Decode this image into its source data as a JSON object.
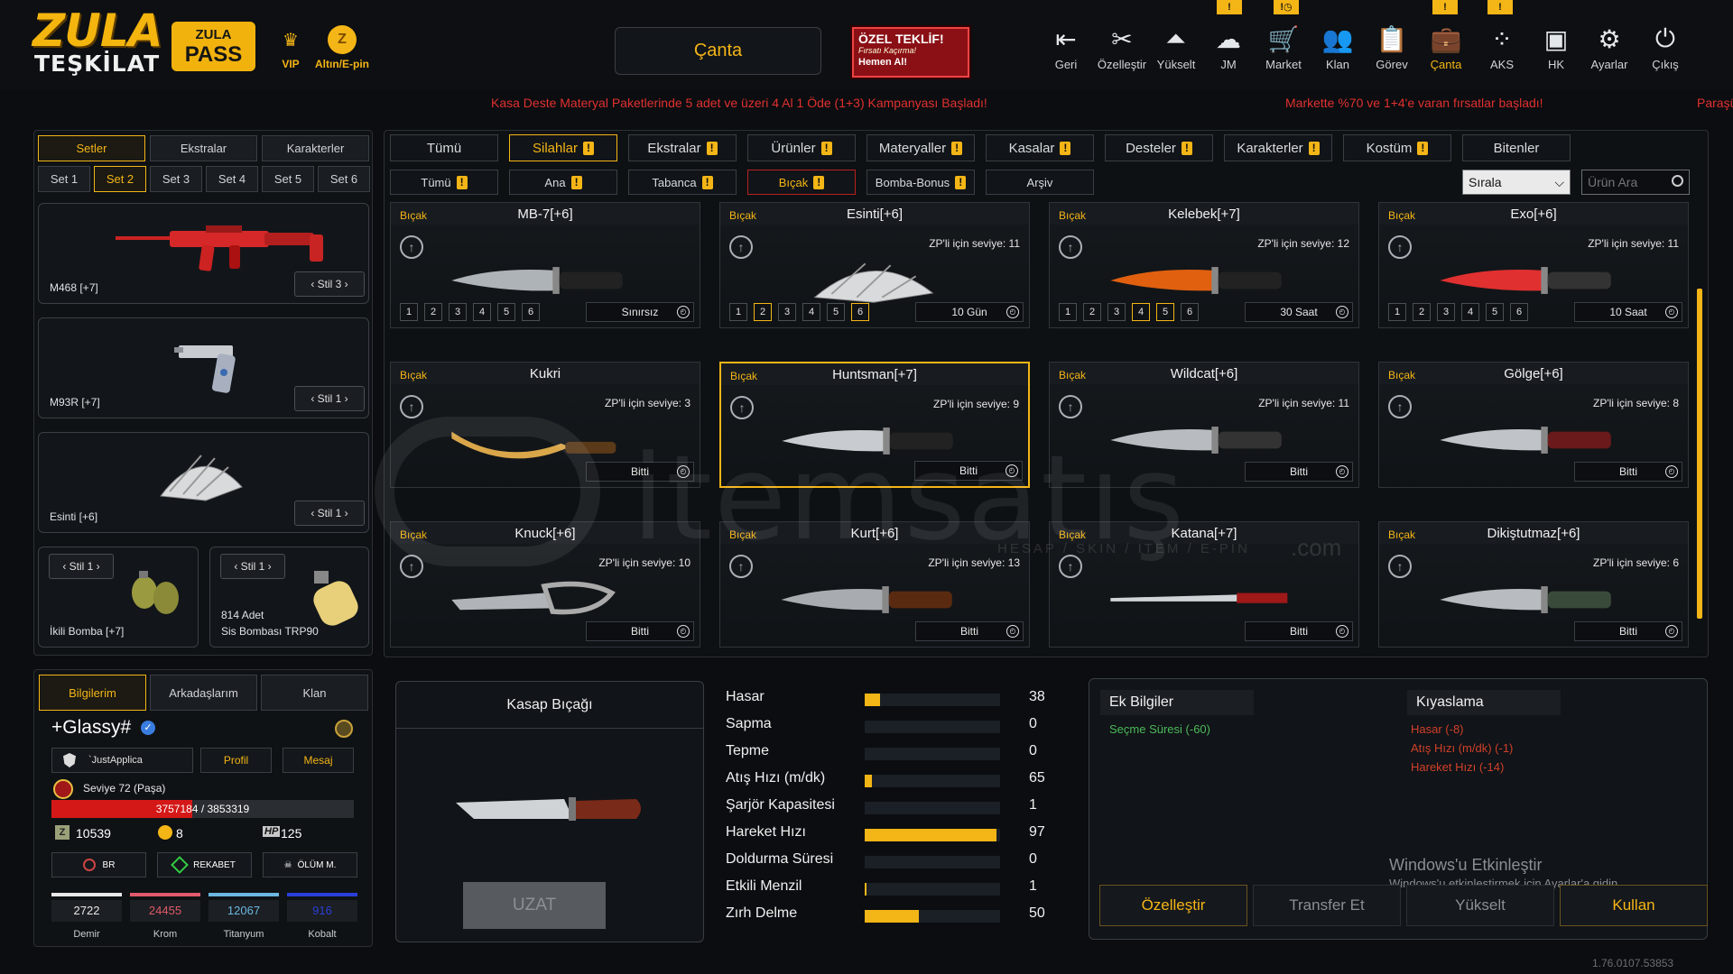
{
  "app": {
    "logo_line1": "ZULA",
    "logo_line2": "TEŞKİLAT",
    "pass_line1": "ZULA",
    "pass_line2": "PASS",
    "vip_label": "VIP",
    "epin_label": "Altın/E-pin",
    "canta_button": "Çanta",
    "offer_title": "ÖZEL TEKLİF!",
    "offer_sub": "Fırsatı Kaçırma!",
    "offer_cta": "Hemen Al!",
    "version": "1.76.0107.53853"
  },
  "nav": [
    {
      "label": "Geri",
      "icon": "back-icon"
    },
    {
      "label": "Özelleştir",
      "icon": "tools-icon"
    },
    {
      "label": "Yükselt",
      "icon": "upgrade-icon"
    },
    {
      "label": "JM",
      "icon": "cloud-icon"
    },
    {
      "label": "Market",
      "icon": "cart-icon"
    },
    {
      "label": "Klan",
      "icon": "clan-icon"
    },
    {
      "label": "Görev",
      "icon": "clipboard-icon"
    },
    {
      "label": "Çanta",
      "icon": "bag-icon"
    },
    {
      "label": "AKS",
      "icon": "dots-icon"
    },
    {
      "label": "HK",
      "icon": "wallet-icon"
    },
    {
      "label": "Ayarlar",
      "icon": "gear-icon"
    },
    {
      "label": "Çıkış",
      "icon": "power-icon"
    }
  ],
  "ticker": [
    "Kasa Deste Materyal Paketlerinde 5 adet ve üzeri 4 Al 1 Öde (1+3) Kampanyası Başladı!",
    "Markette %70 ve 1+4'e varan fırsatlar başladı!",
    "Paraşü"
  ],
  "left": {
    "tabs": [
      "Setler",
      "Ekstralar",
      "Karakterler"
    ],
    "sets": [
      "Set 1",
      "Set 2",
      "Set 3",
      "Set 4",
      "Set 5",
      "Set 6"
    ],
    "slots": [
      {
        "name": "M468 [+7]",
        "stil": "Stil 3"
      },
      {
        "name": "M93R [+7]",
        "stil": "Stil 1"
      },
      {
        "name": "Esinti [+6]",
        "stil": "Stil 1"
      },
      {
        "name": "İkili Bomba [+7]",
        "stil": "Stil 1"
      },
      {
        "name": "Sis Bombası TRP90",
        "stil": "Stil 1",
        "count": "814 Adet"
      }
    ]
  },
  "profile": {
    "tabs": [
      "Bilgilerim",
      "Arkadaşlarım",
      "Klan"
    ],
    "username": "+Glassy#",
    "clan": "`JustApplica",
    "profil_btn": "Profil",
    "mesaj_btn": "Mesaj",
    "level": "Seviye 72 (Paşa)",
    "xp_current": "3757184",
    "xp_total": "/ 3853319",
    "xp_progress": 0.975,
    "zp": "10539",
    "gold": "8",
    "hp_label": "HP",
    "hp": "125",
    "modes": [
      "BR",
      "REKABET",
      "ÖLÜM M."
    ],
    "materials": [
      {
        "label": "Demir",
        "value": "2722",
        "color": "#e8e8e8"
      },
      {
        "label": "Krom",
        "value": "24455",
        "color": "#e05a6a"
      },
      {
        "label": "Titanyum",
        "value": "12067",
        "color": "#6ab8e0"
      },
      {
        "label": "Kobalt",
        "value": "916",
        "color": "#2a3fd8"
      }
    ]
  },
  "catalog": {
    "tabs1": [
      "Tümü",
      "Silahlar",
      "Ekstralar",
      "Ürünler",
      "Materyaller",
      "Kasalar",
      "Desteler",
      "Karakterler",
      "Kostüm",
      "Bitenler"
    ],
    "tabs2": [
      "Tümü",
      "Ana",
      "Tabanca",
      "Bıçak",
      "Bomba-Bonus",
      "Arşiv"
    ],
    "sort_label": "Sırala",
    "search_placeholder": "Ürün Ara",
    "items": [
      {
        "cat": "Bıçak",
        "name": "MB-7[+6]",
        "zp": "",
        "dur": "Sınırsız",
        "levels": [
          "1",
          "2",
          "3",
          "4",
          "5",
          "6"
        ],
        "on": []
      },
      {
        "cat": "Bıçak",
        "name": "Esinti[+6]",
        "zp": "ZP'li için seviye: 11",
        "dur": "10 Gün",
        "levels": [
          "1",
          "2",
          "3",
          "4",
          "5",
          "6"
        ],
        "on": [
          1,
          5
        ]
      },
      {
        "cat": "Bıçak",
        "name": "Kelebek[+7]",
        "zp": "ZP'li için seviye: 12",
        "dur": "30 Saat",
        "levels": [
          "1",
          "2",
          "3",
          "4",
          "5",
          "6"
        ],
        "on": [
          3,
          4
        ]
      },
      {
        "cat": "Bıçak",
        "name": "Exo[+6]",
        "zp": "ZP'li için seviye: 11",
        "dur": "10 Saat",
        "levels": [
          "1",
          "2",
          "3",
          "4",
          "5",
          "6"
        ],
        "on": []
      },
      {
        "cat": "Bıçak",
        "name": "Kukri",
        "zp": "ZP'li için seviye: 3",
        "dur": "Bitti",
        "levels": [],
        "on": []
      },
      {
        "cat": "Bıçak",
        "name": "Huntsman[+7]",
        "zp": "ZP'li için seviye: 9",
        "dur": "Bitti",
        "levels": [],
        "on": []
      },
      {
        "cat": "Bıçak",
        "name": "Wildcat[+6]",
        "zp": "ZP'li için seviye: 11",
        "dur": "Bitti",
        "levels": [],
        "on": []
      },
      {
        "cat": "Bıçak",
        "name": "Gölge[+6]",
        "zp": "ZP'li için seviye: 8",
        "dur": "Bitti",
        "levels": [],
        "on": []
      },
      {
        "cat": "Bıçak",
        "name": "Knuck[+6]",
        "zp": "ZP'li için seviye: 10",
        "dur": "Bitti",
        "levels": [],
        "on": []
      },
      {
        "cat": "Bıçak",
        "name": "Kurt[+6]",
        "zp": "ZP'li için seviye: 13",
        "dur": "Bitti",
        "levels": [],
        "on": []
      },
      {
        "cat": "Bıçak",
        "name": "Katana[+7]",
        "zp": "",
        "dur": "Bitti",
        "levels": [],
        "on": []
      },
      {
        "cat": "Bıçak",
        "name": "Dikiştutmaz[+6]",
        "zp": "ZP'li için seviye: 6",
        "dur": "Bitti",
        "levels": [],
        "on": []
      }
    ]
  },
  "preview": {
    "title": "Kasap Bıçağı",
    "uzat_button": "UZAT"
  },
  "stats": [
    {
      "label": "Hasar",
      "value": "38",
      "fill": 0.11
    },
    {
      "label": "Sapma",
      "value": "0",
      "fill": 0
    },
    {
      "label": "Tepme",
      "value": "0",
      "fill": 0
    },
    {
      "label": "Atış Hızı (m/dk)",
      "value": "65",
      "fill": 0.05
    },
    {
      "label": "Şarjör Kapasitesi",
      "value": "1",
      "fill": 0
    },
    {
      "label": "Hareket Hızı",
      "value": "97",
      "fill": 0.97
    },
    {
      "label": "Doldurma Süresi",
      "value": "0",
      "fill": 0
    },
    {
      "label": "Etkili Menzil",
      "value": "1",
      "fill": 0.01
    },
    {
      "label": "Zırh Delme",
      "value": "50",
      "fill": 0.4
    }
  ],
  "info": {
    "ek_title": "Ek Bilgiler",
    "ek_items": [
      "Seçme Süresi (-60)"
    ],
    "cmp_title": "Kıyaslama",
    "cmp_items": [
      "Hasar (-8)",
      "Atış Hızı (m/dk) (-1)",
      "Hareket Hızı (-14)"
    ],
    "buttons": [
      "Özelleştir",
      "Transfer Et",
      "Yükselt",
      "Kullan"
    ],
    "win_title": "Windows'u Etkinleştir",
    "win_sub": "Windows'u etkinleştirmek için Ayarlar'a gidin."
  },
  "watermark": {
    "brand": "itemsatış",
    "sub": "HESAP / SKIN / ITEM / E-PIN",
    "com": ".com"
  }
}
